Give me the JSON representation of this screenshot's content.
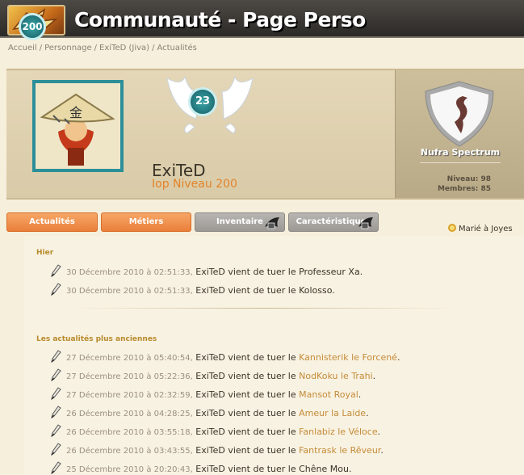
{
  "header": {
    "title": "Communauté - Page Perso"
  },
  "breadcrumb": [
    "Accueil",
    "Personnage",
    "ExiTeD (Jiva)",
    "Actualités"
  ],
  "profile": {
    "level": "200",
    "ally_level": "23",
    "name": "ExiTeD",
    "class_level": "Iop Niveau 200"
  },
  "guild": {
    "name": "Nufra Spectrum",
    "niveau_label": "Niveau:",
    "niveau_value": "98",
    "membres_label": "Membres:",
    "membres_value": "85"
  },
  "tabs": [
    {
      "label": "Actualités",
      "style": "orange",
      "locked": false
    },
    {
      "label": "Métiers",
      "style": "orange",
      "locked": false
    },
    {
      "label": "Inventaire",
      "style": "grey",
      "locked": true
    },
    {
      "label": "Caractéristiques",
      "style": "grey",
      "locked": true
    }
  ],
  "married": {
    "prefix": "Marié à",
    "partner": "Joyes"
  },
  "sections": {
    "recent_title": "Hier",
    "older_title": "Les actualités plus anciennes"
  },
  "news_recent": [
    {
      "date": "30 Décembre 2010 à 02:51:33,",
      "text": "ExiTeD vient de tuer le",
      "victim": "Professeur Xa.",
      "link": false
    },
    {
      "date": "30 Décembre 2010 à 02:51:33,",
      "text": "ExiTeD vient de tuer le",
      "victim": "Kolosso.",
      "link": false
    }
  ],
  "news_older": [
    {
      "date": "27 Décembre 2010 à 05:40:54,",
      "text": "ExiTeD vient de tuer le",
      "victim": "Kannisterik le Forcené",
      "tail": ".",
      "link": true
    },
    {
      "date": "27 Décembre 2010 à 05:22:36,",
      "text": "ExiTeD vient de tuer le",
      "victim": "NodKoku le Trahi",
      "tail": ".",
      "link": true
    },
    {
      "date": "27 Décembre 2010 à 02:32:59,",
      "text": "ExiTeD vient de tuer le",
      "victim": "Mansot Royal",
      "tail": ".",
      "link": true
    },
    {
      "date": "26 Décembre 2010 à 04:28:25,",
      "text": "ExiTeD vient de tuer le",
      "victim": "Ameur la Laide",
      "tail": ".",
      "link": true
    },
    {
      "date": "26 Décembre 2010 à 03:55:18,",
      "text": "ExiTeD vient de tuer le",
      "victim": "Fanlabiz le Véloce",
      "tail": ".",
      "link": true
    },
    {
      "date": "26 Décembre 2010 à 03:43:55,",
      "text": "ExiTeD vient de tuer le",
      "victim": "Fantrask le Rêveur",
      "tail": ".",
      "link": true
    },
    {
      "date": "25 Décembre 2010 à 20:20:43,",
      "text": "ExiTeD vient de tuer le",
      "victim": "Chêne Mou.",
      "tail": "",
      "link": false
    }
  ],
  "colors": {
    "accent_orange": "#ea7f3a",
    "teal": "#2c8f98",
    "link": "#c48b38"
  }
}
